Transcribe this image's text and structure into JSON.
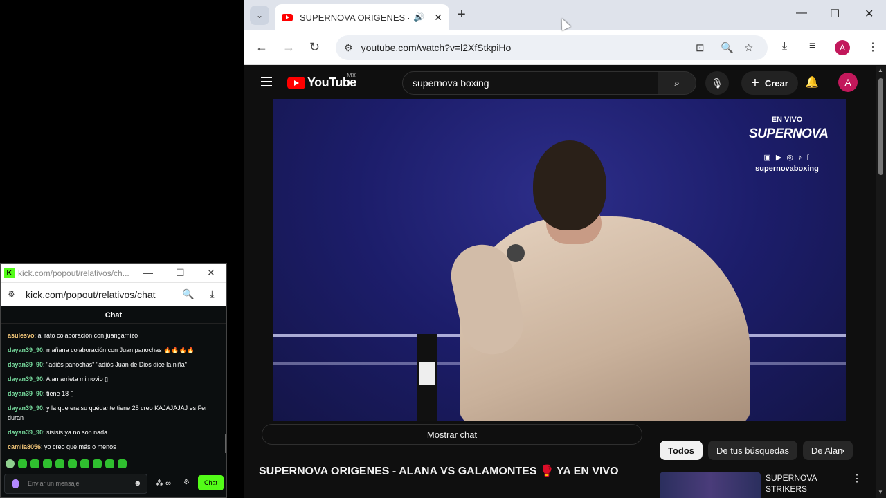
{
  "browser": {
    "tab": {
      "title": "SUPERNOVA ORIGENES - AL",
      "audio_icon": "speaker-icon",
      "close_label": "✕"
    },
    "newtab_label": "+",
    "url": "youtube.com/watch?v=l2XfStkpiHo",
    "profile_initial": "A"
  },
  "youtube": {
    "logo_text": "YouTube",
    "country_code": "MX",
    "search_query": "supernova boxing",
    "create_label": "Crear",
    "avatar_initial": "A",
    "overlay": {
      "live": "EN VIVO",
      "brand": "SUPERNOVA",
      "social": "▣ ▶ ◎ ♪ f",
      "handle": "supernovaboxing"
    },
    "show_chat_label": "Mostrar chat",
    "video_title": "SUPERNOVA ORIGENES - ALANA VS GALAMONTES 🥊 YA EN VIVO",
    "chips": [
      "Todos",
      "De tus búsquedas",
      "De Alan"
    ],
    "recommendation_title": "SUPERNOVA STRIKERS AMIGO"
  },
  "kick": {
    "window_title": "kick.com/popout/relativos/ch...",
    "url": "kick.com/popout/relativos/chat",
    "chat_header": "Chat",
    "messages": [
      {
        "user": "asulesvo",
        "color": "#f5c87a",
        "text": ": al rato colaboración con juangarnizo"
      },
      {
        "user": "dayan39_90",
        "color": "#76d99c",
        "text": ": mañana colaboración con Juan panochas 🔥🔥🔥🔥"
      },
      {
        "user": "dayan39_90",
        "color": "#76d99c",
        "text": ": \"adiós panochas\" \"adiós Juan de Dios dice la niña\""
      },
      {
        "user": "dayan39_90",
        "color": "#76d99c",
        "text": ": Alan arrieta mi novio ▯"
      },
      {
        "user": "dayan39_90",
        "color": "#76d99c",
        "text": ": tiene 18 ▯"
      },
      {
        "user": "dayan39_90",
        "color": "#76d99c",
        "text": ": y la que era su quédante tiene 25 creo KAJAJAJAJ es Fer duran"
      },
      {
        "user": "dayan39_90",
        "color": "#76d99c",
        "text": ": sisisis,ya no son nada"
      },
      {
        "user": "camila8056",
        "color": "#f5c87a",
        "text": ": yo creo que más o menos"
      }
    ],
    "input_placeholder": "Enviar un mensaje",
    "points_label": "∞",
    "send_label": "Chat"
  }
}
